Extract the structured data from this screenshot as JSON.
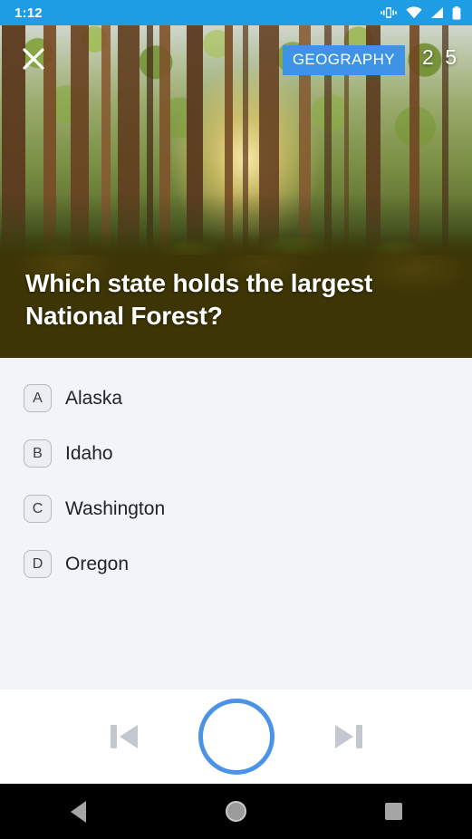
{
  "status_bar": {
    "time": "1:12",
    "icons": [
      "vibrate-icon",
      "wifi-icon",
      "signal-icon",
      "battery-icon"
    ],
    "background_color": "#1e9ce4"
  },
  "hero": {
    "image_description": "sunlit pine forest with tall tree trunks",
    "close_label": "✕",
    "category": "GEOGRAPHY",
    "counter": "2 5",
    "badge_color": "#3d93e6"
  },
  "question": {
    "text": "Which state holds the largest National Forest?",
    "band_color": "#3d3505"
  },
  "answers": [
    {
      "letter": "A",
      "label": "Alaska"
    },
    {
      "letter": "B",
      "label": "Idaho"
    },
    {
      "letter": "C",
      "label": "Washington"
    },
    {
      "letter": "D",
      "label": "Oregon"
    }
  ],
  "player": {
    "previous_icon": "skip-previous-icon",
    "record_icon": "record-circle-icon",
    "next_icon": "skip-next-icon",
    "accent_color": "#4a93e8"
  },
  "nav_bar": {
    "back_icon": "back-triangle-icon",
    "home_icon": "home-circle-icon",
    "recents_icon": "recents-square-icon"
  }
}
